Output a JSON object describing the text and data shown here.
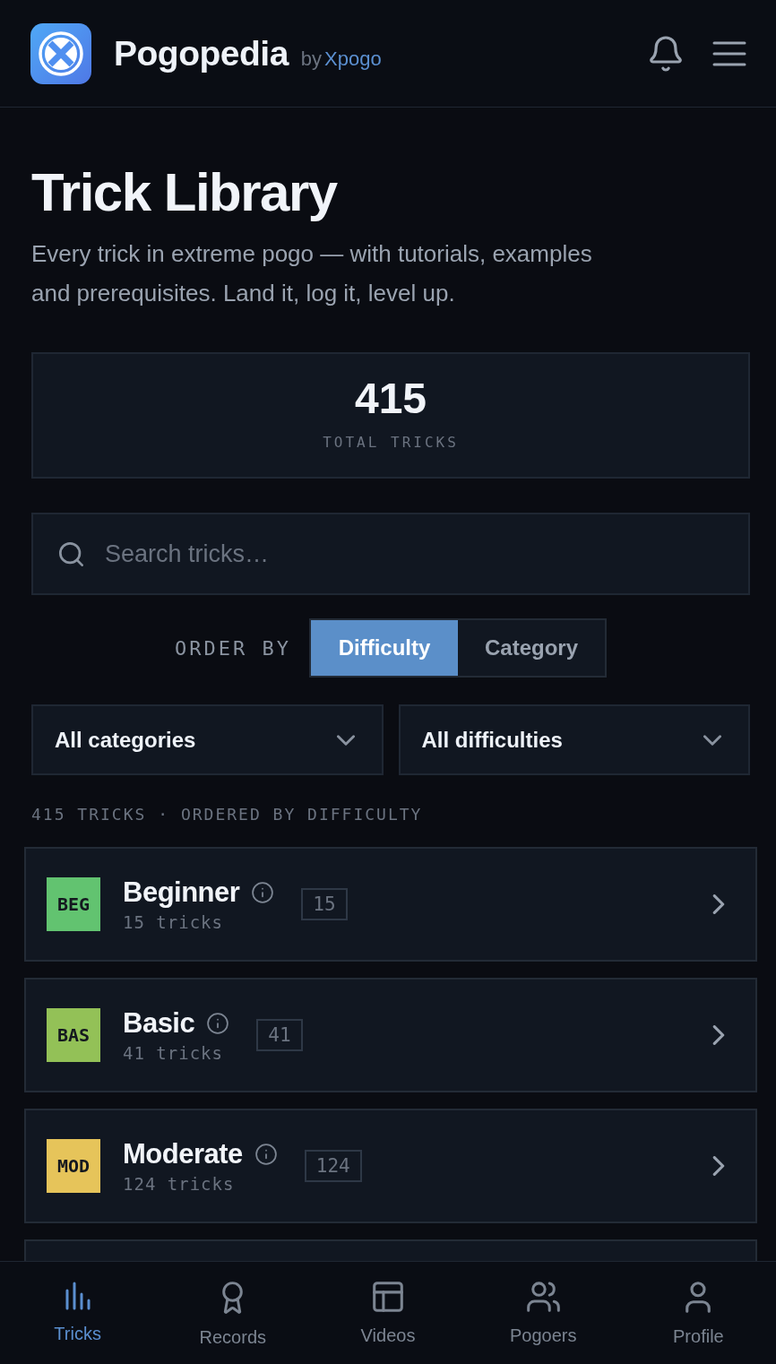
{
  "header": {
    "title": "Pogopedia",
    "by": "by",
    "brand": "Xpogo"
  },
  "page": {
    "title": "Trick Library",
    "subtitle": "Every trick in extreme pogo — with tutorials, examples and prerequisites. Land it, log it, level up."
  },
  "stats": {
    "value": "415",
    "label": "TOTAL TRICKS"
  },
  "search": {
    "placeholder": "Search tricks…"
  },
  "order_by": {
    "label": "ORDER BY",
    "options": [
      {
        "label": "Difficulty",
        "selected": true
      },
      {
        "label": "Category",
        "selected": false
      }
    ]
  },
  "filters": [
    {
      "value": "All categories"
    },
    {
      "value": "All difficulties"
    }
  ],
  "summary": "415 TRICKS · ORDERED BY DIFFICULTY",
  "groups": [
    {
      "code": "BEG",
      "color": "#62c370",
      "name": "Beginner",
      "subtitle": "15 tricks",
      "count": "15"
    },
    {
      "code": "BAS",
      "color": "#93c157",
      "name": "Basic",
      "subtitle": "41 tricks",
      "count": "41"
    },
    {
      "code": "MOD",
      "color": "#e6c45a",
      "name": "Moderate",
      "subtitle": "124 tricks",
      "count": "124"
    }
  ],
  "nav": [
    {
      "label": "Tricks",
      "selected": true
    },
    {
      "label": "Records",
      "selected": false
    },
    {
      "label": "Videos",
      "selected": false
    },
    {
      "label": "Pogoers",
      "selected": false
    },
    {
      "label": "Profile",
      "selected": false
    }
  ]
}
